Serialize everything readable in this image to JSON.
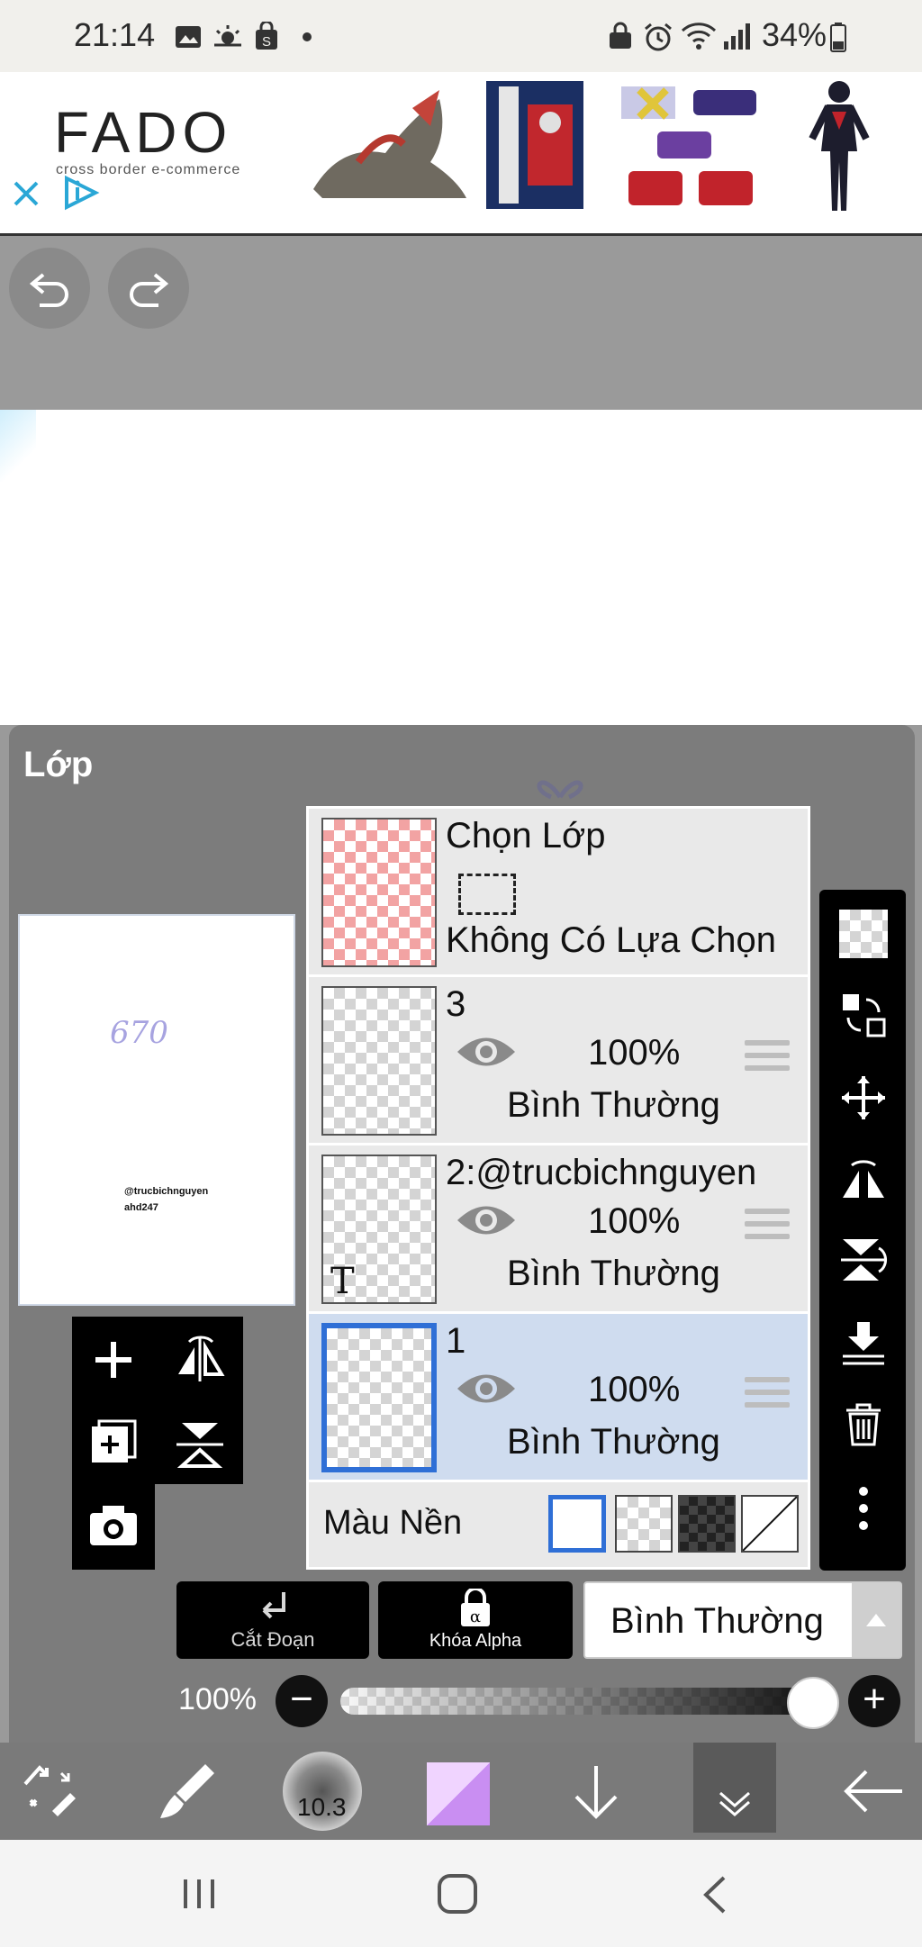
{
  "status_bar": {
    "time": "21:14",
    "battery": "34%"
  },
  "ad": {
    "brand": "FADO",
    "tagline": "cross border e-commerce"
  },
  "panel": {
    "title": "Lớp"
  },
  "preview": {
    "number": "670",
    "credit_line1": "@trucbichnguyen",
    "credit_line2": "ahd247"
  },
  "layers": {
    "selection": {
      "title": "Chọn Lớp",
      "status": "Không Có Lựa Chọn"
    },
    "items": [
      {
        "name": "3",
        "opacity": "100%",
        "blend": "Bình Thường"
      },
      {
        "name": "2:@trucbichnguyen",
        "opacity": "100%",
        "blend": "Bình Thường"
      },
      {
        "name": "1",
        "opacity": "100%",
        "blend": "Bình Thường"
      }
    ]
  },
  "background_color": {
    "label": "Màu Nền"
  },
  "buttons": {
    "clip": "Cắt Đoạn",
    "alpha_lock": "Khóa Alpha"
  },
  "blend_mode": {
    "selected": "Bình Thường"
  },
  "opacity_slider": {
    "label": "100%",
    "value": 1.0
  },
  "brush": {
    "size": "10.3"
  },
  "colors": {
    "accent_selected": "#2f6fd6",
    "selected_row_bg": "#cfdcef",
    "panel_bg": "#7c7c7c",
    "current_color": "#d9a8f5"
  }
}
